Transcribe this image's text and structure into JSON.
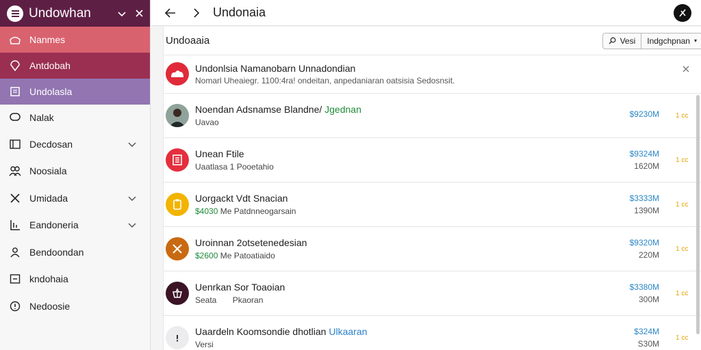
{
  "sidebar": {
    "title": "Undowhan",
    "items": [
      {
        "label": "Nanmes",
        "icon": "home-icon"
      },
      {
        "label": "Antdobah",
        "icon": "location-pin-icon"
      },
      {
        "label": "Undolasla",
        "icon": "document-icon"
      },
      {
        "label": "Nalak",
        "icon": "chat-icon"
      },
      {
        "label": "Decdosan",
        "icon": "list-icon"
      },
      {
        "label": "Noosiala",
        "icon": "people-icon"
      },
      {
        "label": "Umidada",
        "icon": "tools-icon"
      },
      {
        "label": "Eandoneria",
        "icon": "chart-icon"
      },
      {
        "label": "Bendoondan",
        "icon": "person-icon"
      },
      {
        "label": "kndohaia",
        "icon": "card-icon"
      },
      {
        "label": "Nedoosie",
        "icon": "info-icon"
      }
    ]
  },
  "topbar": {
    "title": "Undonaia"
  },
  "main": {
    "section_title": "Undoaaia",
    "search_label": "Vesi",
    "dropdown_label": "Indgchpnan"
  },
  "notice": {
    "title": "Undonlsia Namanobarn Unnadondian",
    "subtitle": "Nomarl Uheaiegr. 1100:4ra! ondeitan, anpedaniaran oatsisia Sedosnsit."
  },
  "rows": [
    {
      "title": "Noendan Adsnamse Blandne/",
      "title_accent": "Jgednan",
      "sub": "Uavao",
      "amount": "$9230M",
      "amount2": "",
      "stat": "1 cc"
    },
    {
      "title": "Unean Ftile",
      "title_accent": "",
      "sub": "Uaatlasa 1 Pooetahio",
      "amount": "$9324M",
      "amount2": "1620M",
      "stat": "1 cc"
    },
    {
      "title": "Uorgackt Vdt Snacian",
      "title_accent": "",
      "sub_accent": "$4030",
      "sub": "Me Patdnneogarsain",
      "amount": "$3333M",
      "amount2": "1390M",
      "stat": "1 cc"
    },
    {
      "title": "Uroinnan 2otsetenedesian",
      "title_accent": "",
      "sub_accent": "$2600",
      "sub": "Me Patoatiaido",
      "amount": "$9320M",
      "amount2": "220M",
      "stat": "1 cc"
    },
    {
      "title": "Uenrkan Sor Toaoian",
      "title_accent": "",
      "sub": "Seata       Pkaoran",
      "amount": "$3380M",
      "amount2": "300M",
      "stat": "1 cc"
    },
    {
      "title": "Uaardeln Koomsondie dhotlian",
      "title_accent": "Ulkaaran",
      "sub": "Versi",
      "amount": "$324M",
      "amount2": "S30M",
      "stat": "1 cc"
    }
  ],
  "colors": {
    "brand": "#5e1f45",
    "active1": "#d9626f",
    "active2": "#9a2f52",
    "active3": "#9275b1",
    "amount": "#2a86c7",
    "positive": "#1f8a3a",
    "accent_link": "#2a7fcc",
    "notice_icon": "#e02a3a"
  }
}
